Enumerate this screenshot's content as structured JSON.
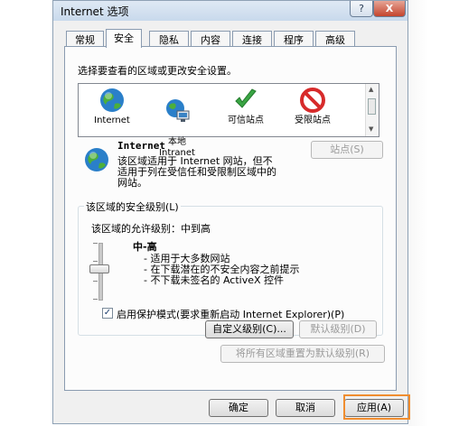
{
  "window": {
    "title": "Internet 选项",
    "help_label": "?",
    "close_label": "X"
  },
  "tabs": [
    "常规",
    "安全",
    "隐私",
    "内容",
    "连接",
    "程序",
    "高级"
  ],
  "active_tab": "安全",
  "security": {
    "select_zone_label": "选择要查看的区域或更改安全设置。",
    "zones": [
      {
        "label": "Internet",
        "icon": "globe-icon"
      },
      {
        "label": "本地\nIntranet",
        "icon": "intranet-icon"
      },
      {
        "label": "可信站点",
        "icon": "checkmark-icon"
      },
      {
        "label": "受限站点",
        "icon": "restricted-icon"
      }
    ],
    "selected_zone": {
      "name": "Internet",
      "description": "该区域适用于 Internet 网站，但不适用于列在受信任和受限制区域中的网站。",
      "sites_button": "站点(S)"
    },
    "level_group": {
      "title": "该区域的安全级别(L)",
      "allowed_levels_label": "该区域的允许级别：中到高",
      "level_name": "中-高",
      "bullets": [
        "- 适用于大多数网站",
        "- 在下载潜在的不安全内容之前提示",
        "- 不下载未签名的 ActiveX 控件"
      ],
      "protected_mode_label": "启用保护模式(要求重新启动 Internet Explorer)(P)",
      "protected_mode_checked": true,
      "custom_level_button": "自定义级别(C)...",
      "default_level_button": "默认级别(D)"
    },
    "reset_all_button": "将所有区域重置为默认级别(R)"
  },
  "footer": {
    "ok": "确定",
    "cancel": "取消",
    "apply": "应用(A)"
  },
  "colors": {
    "highlight": "#f08d2f",
    "disabled_text": "#9a9a9a"
  }
}
